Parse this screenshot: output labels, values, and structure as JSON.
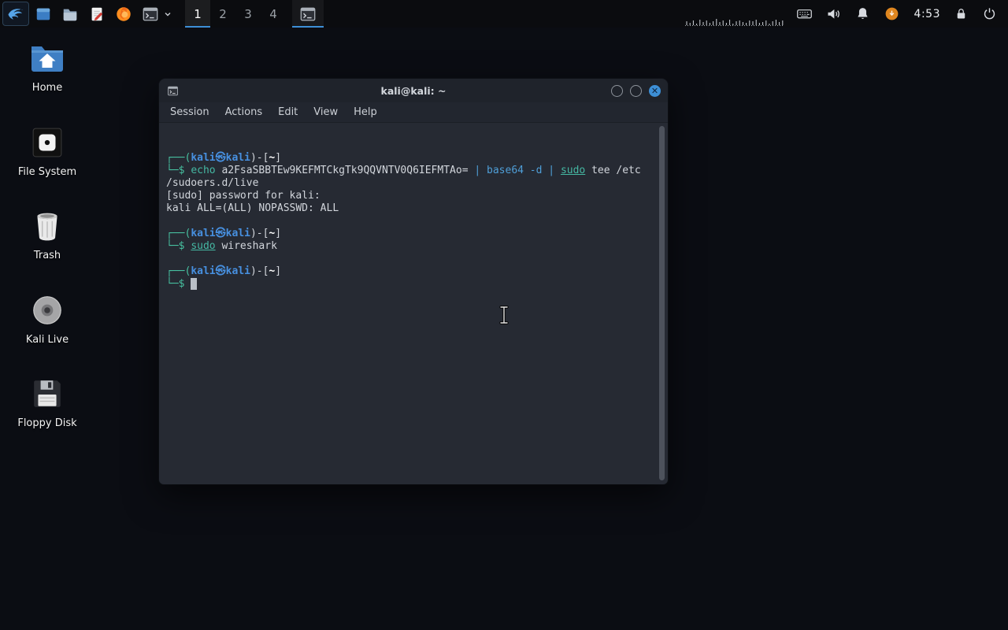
{
  "colors": {
    "accent": "#3d8fd6",
    "close_button": "#3d8fd6",
    "prompt_green": "#47c0a0",
    "prompt_blue": "#4790e0",
    "cmd_teal": "#45b8a3",
    "pipe_blue": "#4f9fd8",
    "term_fg": "#d2d6dc",
    "cursor": "#b9bfc7",
    "orange_status": "#df861f"
  },
  "panel": {
    "menu_button_icon": "kali-logo-icon",
    "launchers": [
      {
        "name": "window-manager-launcher",
        "icon": "window-icon"
      },
      {
        "name": "file-manager-launcher",
        "icon": "file-manager-icon"
      },
      {
        "name": "text-editor-launcher",
        "icon": "text-editor-icon"
      },
      {
        "name": "firefox-launcher",
        "icon": "firefox-icon"
      },
      {
        "name": "terminal-launcher",
        "icon": "terminal-icon",
        "dropdown": true
      }
    ],
    "workspaces": [
      {
        "label": "1",
        "active": true
      },
      {
        "label": "2",
        "active": false
      },
      {
        "label": "3",
        "active": false
      },
      {
        "label": "4",
        "active": false
      }
    ],
    "taskbar": [
      {
        "name": "taskbar-terminal-window",
        "icon": "terminal-icon",
        "active": true
      }
    ],
    "status_icons": [
      {
        "name": "keyboard-indicator",
        "icon": "keyboard-icon"
      },
      {
        "name": "volume-indicator",
        "icon": "volume-icon"
      },
      {
        "name": "notifications-indicator",
        "icon": "bell-icon"
      },
      {
        "name": "updates-indicator",
        "icon": "orange-status-icon"
      }
    ],
    "clock": "4:53",
    "session_icons": [
      {
        "name": "lock-screen-button",
        "icon": "lock-icon"
      },
      {
        "name": "power-button",
        "icon": "power-icon"
      }
    ]
  },
  "desktop_icons": [
    {
      "id": "home",
      "label": "Home",
      "icon": "home-folder-icon"
    },
    {
      "id": "filesystem",
      "label": "File System",
      "icon": "filesystem-icon"
    },
    {
      "id": "trash",
      "label": "Trash",
      "icon": "trash-icon"
    },
    {
      "id": "kali-live",
      "label": "Kali Live",
      "icon": "disc-icon"
    },
    {
      "id": "floppy",
      "label": "Floppy Disk",
      "icon": "floppy-icon"
    }
  ],
  "terminal": {
    "title": "kali@kali: ~",
    "menu": [
      "Session",
      "Actions",
      "Edit",
      "View",
      "Help"
    ],
    "lines": [
      [
        {
          "t": "┌──(",
          "c": "g"
        },
        {
          "t": "kali㉿kali",
          "c": "b"
        },
        {
          "t": ")-[",
          "c": "w"
        },
        {
          "t": "~",
          "c": "wb"
        },
        {
          "t": "]",
          "c": "w"
        }
      ],
      [
        {
          "t": "└─$",
          "c": "g"
        },
        {
          "t": " ",
          "c": "f"
        },
        {
          "t": "echo",
          "c": "t"
        },
        {
          "t": " a2FsaSBBTEw9KEFMTCkgTk9QQVNTV0Q6IEFMTAo= ",
          "c": "f"
        },
        {
          "t": "| ",
          "c": "p"
        },
        {
          "t": "base64 -d",
          "c": "p"
        },
        {
          "t": " ",
          "c": "f"
        },
        {
          "t": "|",
          "c": "p"
        },
        {
          "t": " ",
          "c": "f"
        },
        {
          "t": "sudo",
          "c": "tu"
        },
        {
          "t": " ",
          "c": "f"
        },
        {
          "t": "tee /etc",
          "c": "f"
        }
      ],
      [
        {
          "t": "/sudoers.d/live",
          "c": "f"
        }
      ],
      [
        {
          "t": "[sudo] password for kali:",
          "c": "f"
        }
      ],
      [
        {
          "t": "kali ALL=(ALL) NOPASSWD: ALL",
          "c": "f"
        }
      ],
      [],
      [
        {
          "t": "┌──(",
          "c": "g"
        },
        {
          "t": "kali㉿kali",
          "c": "b"
        },
        {
          "t": ")-[",
          "c": "w"
        },
        {
          "t": "~",
          "c": "wb"
        },
        {
          "t": "]",
          "c": "w"
        }
      ],
      [
        {
          "t": "└─$",
          "c": "g"
        },
        {
          "t": " ",
          "c": "f"
        },
        {
          "t": "sudo",
          "c": "tu"
        },
        {
          "t": " ",
          "c": "f"
        },
        {
          "t": "wireshark",
          "c": "f"
        }
      ],
      [],
      [
        {
          "t": "┌──(",
          "c": "g"
        },
        {
          "t": "kali㉿kali",
          "c": "b"
        },
        {
          "t": ")-[",
          "c": "w"
        },
        {
          "t": "~",
          "c": "wb"
        },
        {
          "t": "]",
          "c": "w"
        }
      ],
      [
        {
          "t": "└─$",
          "c": "g"
        },
        {
          "t": " ",
          "c": "f"
        },
        {
          "t": " ",
          "c": "cur"
        }
      ]
    ]
  }
}
